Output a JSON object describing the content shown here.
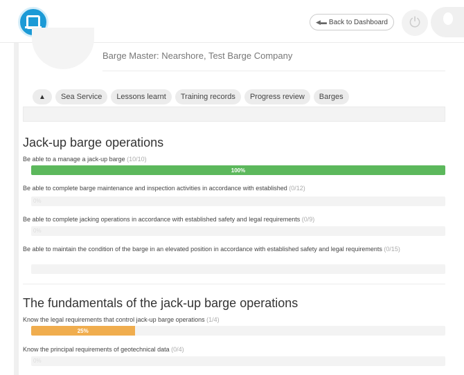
{
  "header": {
    "back_label": "Back to Dashboard",
    "icons": {
      "logo": "app-logo-icon",
      "back": "arrow-left-icon",
      "power": "power-icon",
      "avatar": "user-avatar-icon"
    }
  },
  "profile": {
    "title": "Barge Master: Nearshore, Test Barge Company"
  },
  "tabs": [
    {
      "label": "",
      "icon": "home-icon"
    },
    {
      "label": "Sea Service"
    },
    {
      "label": "Lessons learnt"
    },
    {
      "label": "Training records"
    },
    {
      "label": "Progress review"
    },
    {
      "label": "Barges"
    }
  ],
  "colors": {
    "green": "#5cb85c",
    "orange": "#f0ad4e",
    "track": "#f3f3f3",
    "logo": "#1c9ad6"
  },
  "sections": [
    {
      "title": "Jack-up barge operations",
      "items": [
        {
          "label": "Be able to a manage a jack-up barge",
          "count": "(10/10)",
          "percent": 100,
          "bar_text": "100%"
        },
        {
          "label": "Be able to complete barge maintenance and inspection activities in accordance with established",
          "count": "(0/12)",
          "percent": 0,
          "bar_text": "0%"
        },
        {
          "label": "Be able to complete jacking operations in accordance with established safety and legal requirements",
          "count": "(0/9)",
          "percent": 0,
          "bar_text": "0%"
        },
        {
          "label": "Be able to maintain the condition of the barge in an elevated position in accordance with established safety and legal requirements",
          "count": "(0/15)",
          "percent": 0,
          "bar_text": ""
        }
      ]
    },
    {
      "title": "The fundamentals of the jack-up barge operations",
      "items": [
        {
          "label": "Know the legal requirements that control jack-up barge operations",
          "count": "(1/4)",
          "percent": 25,
          "bar_text": "25%"
        },
        {
          "label": "Know the principal requirements of geotechnical data",
          "count": "(0/4)",
          "percent": 0,
          "bar_text": "0%"
        }
      ]
    }
  ]
}
